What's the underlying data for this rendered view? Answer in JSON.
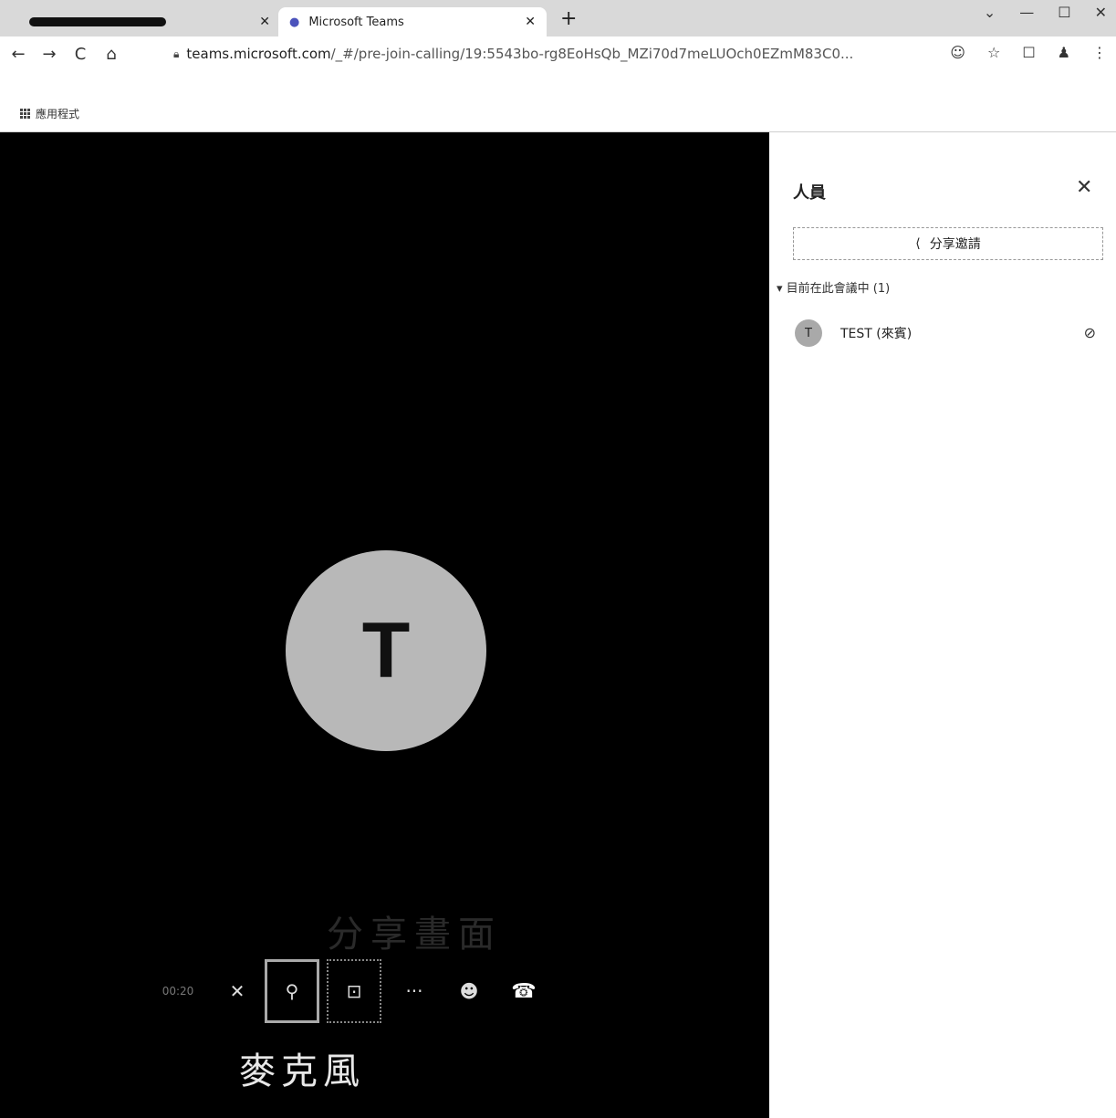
{
  "browser": {
    "tabs": [
      {
        "title": "",
        "redacted": true
      },
      {
        "title": "Microsoft Teams",
        "active": true
      }
    ],
    "new_tab_glyph": "+",
    "window_controls": [
      "⌄",
      "—",
      "☐",
      "✕"
    ],
    "nav": {
      "back": "←",
      "forward": "→",
      "reload": "C",
      "home": "⌂"
    },
    "url_host": "teams.microsoft.com",
    "url_path": "/_#/pre-join-calling/19:5543bo-rg8EoHsQb_MZi70d7meLUOch0EZmM83C0...",
    "toolbar_icons": [
      "☺",
      "☆",
      "☐",
      "♟",
      "⋮"
    ],
    "bookmarks": {
      "apps_label": "應用程式"
    }
  },
  "call": {
    "avatar_initial": "T",
    "share_caption": "分享畫面",
    "timer": "00:20",
    "controls": {
      "camera": "✕",
      "mic": "⚲",
      "share": "⊡",
      "more": "···",
      "people": "☻",
      "hangup": "☎"
    },
    "mic_caption": "麥克風"
  },
  "people_panel": {
    "title": "人員",
    "close": "✕",
    "share_invite_icon": "⟨",
    "share_invite_label": "分享邀請",
    "section_header": "▾ 目前在此會議中 (1)",
    "participants": [
      {
        "initial": "T",
        "name": "TEST (來賓)",
        "mute_icon": "mic-off-icon",
        "mute_glyph": "⊘"
      }
    ]
  },
  "colors": {
    "stage": "#000000",
    "avatar": "#b8b8b8",
    "tabstrip": "#d9d9d9"
  }
}
